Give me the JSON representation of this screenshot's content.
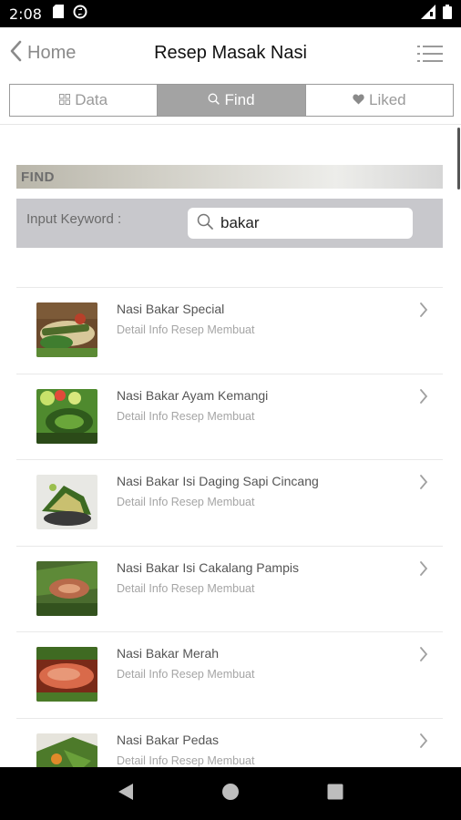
{
  "status_bar": {
    "time": "2:08",
    "icons": [
      "sd-card-icon",
      "sync-icon",
      "signal-icon",
      "battery-icon"
    ]
  },
  "header": {
    "back_label": "Home",
    "title": "Resep Masak Nasi",
    "menu_icon": "list-menu-icon"
  },
  "tabs": [
    {
      "label": "Data",
      "icon": "grid-icon",
      "active": false
    },
    {
      "label": "Find",
      "icon": "search-icon",
      "active": true
    },
    {
      "label": "Liked",
      "icon": "heart-icon",
      "active": false
    }
  ],
  "find": {
    "section_title": "FIND",
    "input_label": "Input Keyword :",
    "keyword": "bakar"
  },
  "results": [
    {
      "title": "Nasi Bakar Special",
      "subtitle": "Detail Info Resep Membuat"
    },
    {
      "title": "Nasi Bakar Ayam Kemangi",
      "subtitle": "Detail Info Resep Membuat"
    },
    {
      "title": "Nasi Bakar Isi Daging Sapi Cincang",
      "subtitle": "Detail Info Resep Membuat"
    },
    {
      "title": "Nasi Bakar Isi Cakalang Pampis",
      "subtitle": "Detail Info Resep Membuat"
    },
    {
      "title": "Nasi Bakar Merah",
      "subtitle": "Detail Info Resep Membuat"
    },
    {
      "title": "Nasi Bakar Pedas",
      "subtitle": "Detail Info Resep Membuat"
    }
  ],
  "nav": [
    "back-triangle-icon",
    "home-circle-icon",
    "recents-square-icon"
  ],
  "colors": {
    "active_tab": "#a3a3a3",
    "search_panel": "#c8c8cc",
    "text_muted": "#a5a5a5"
  }
}
